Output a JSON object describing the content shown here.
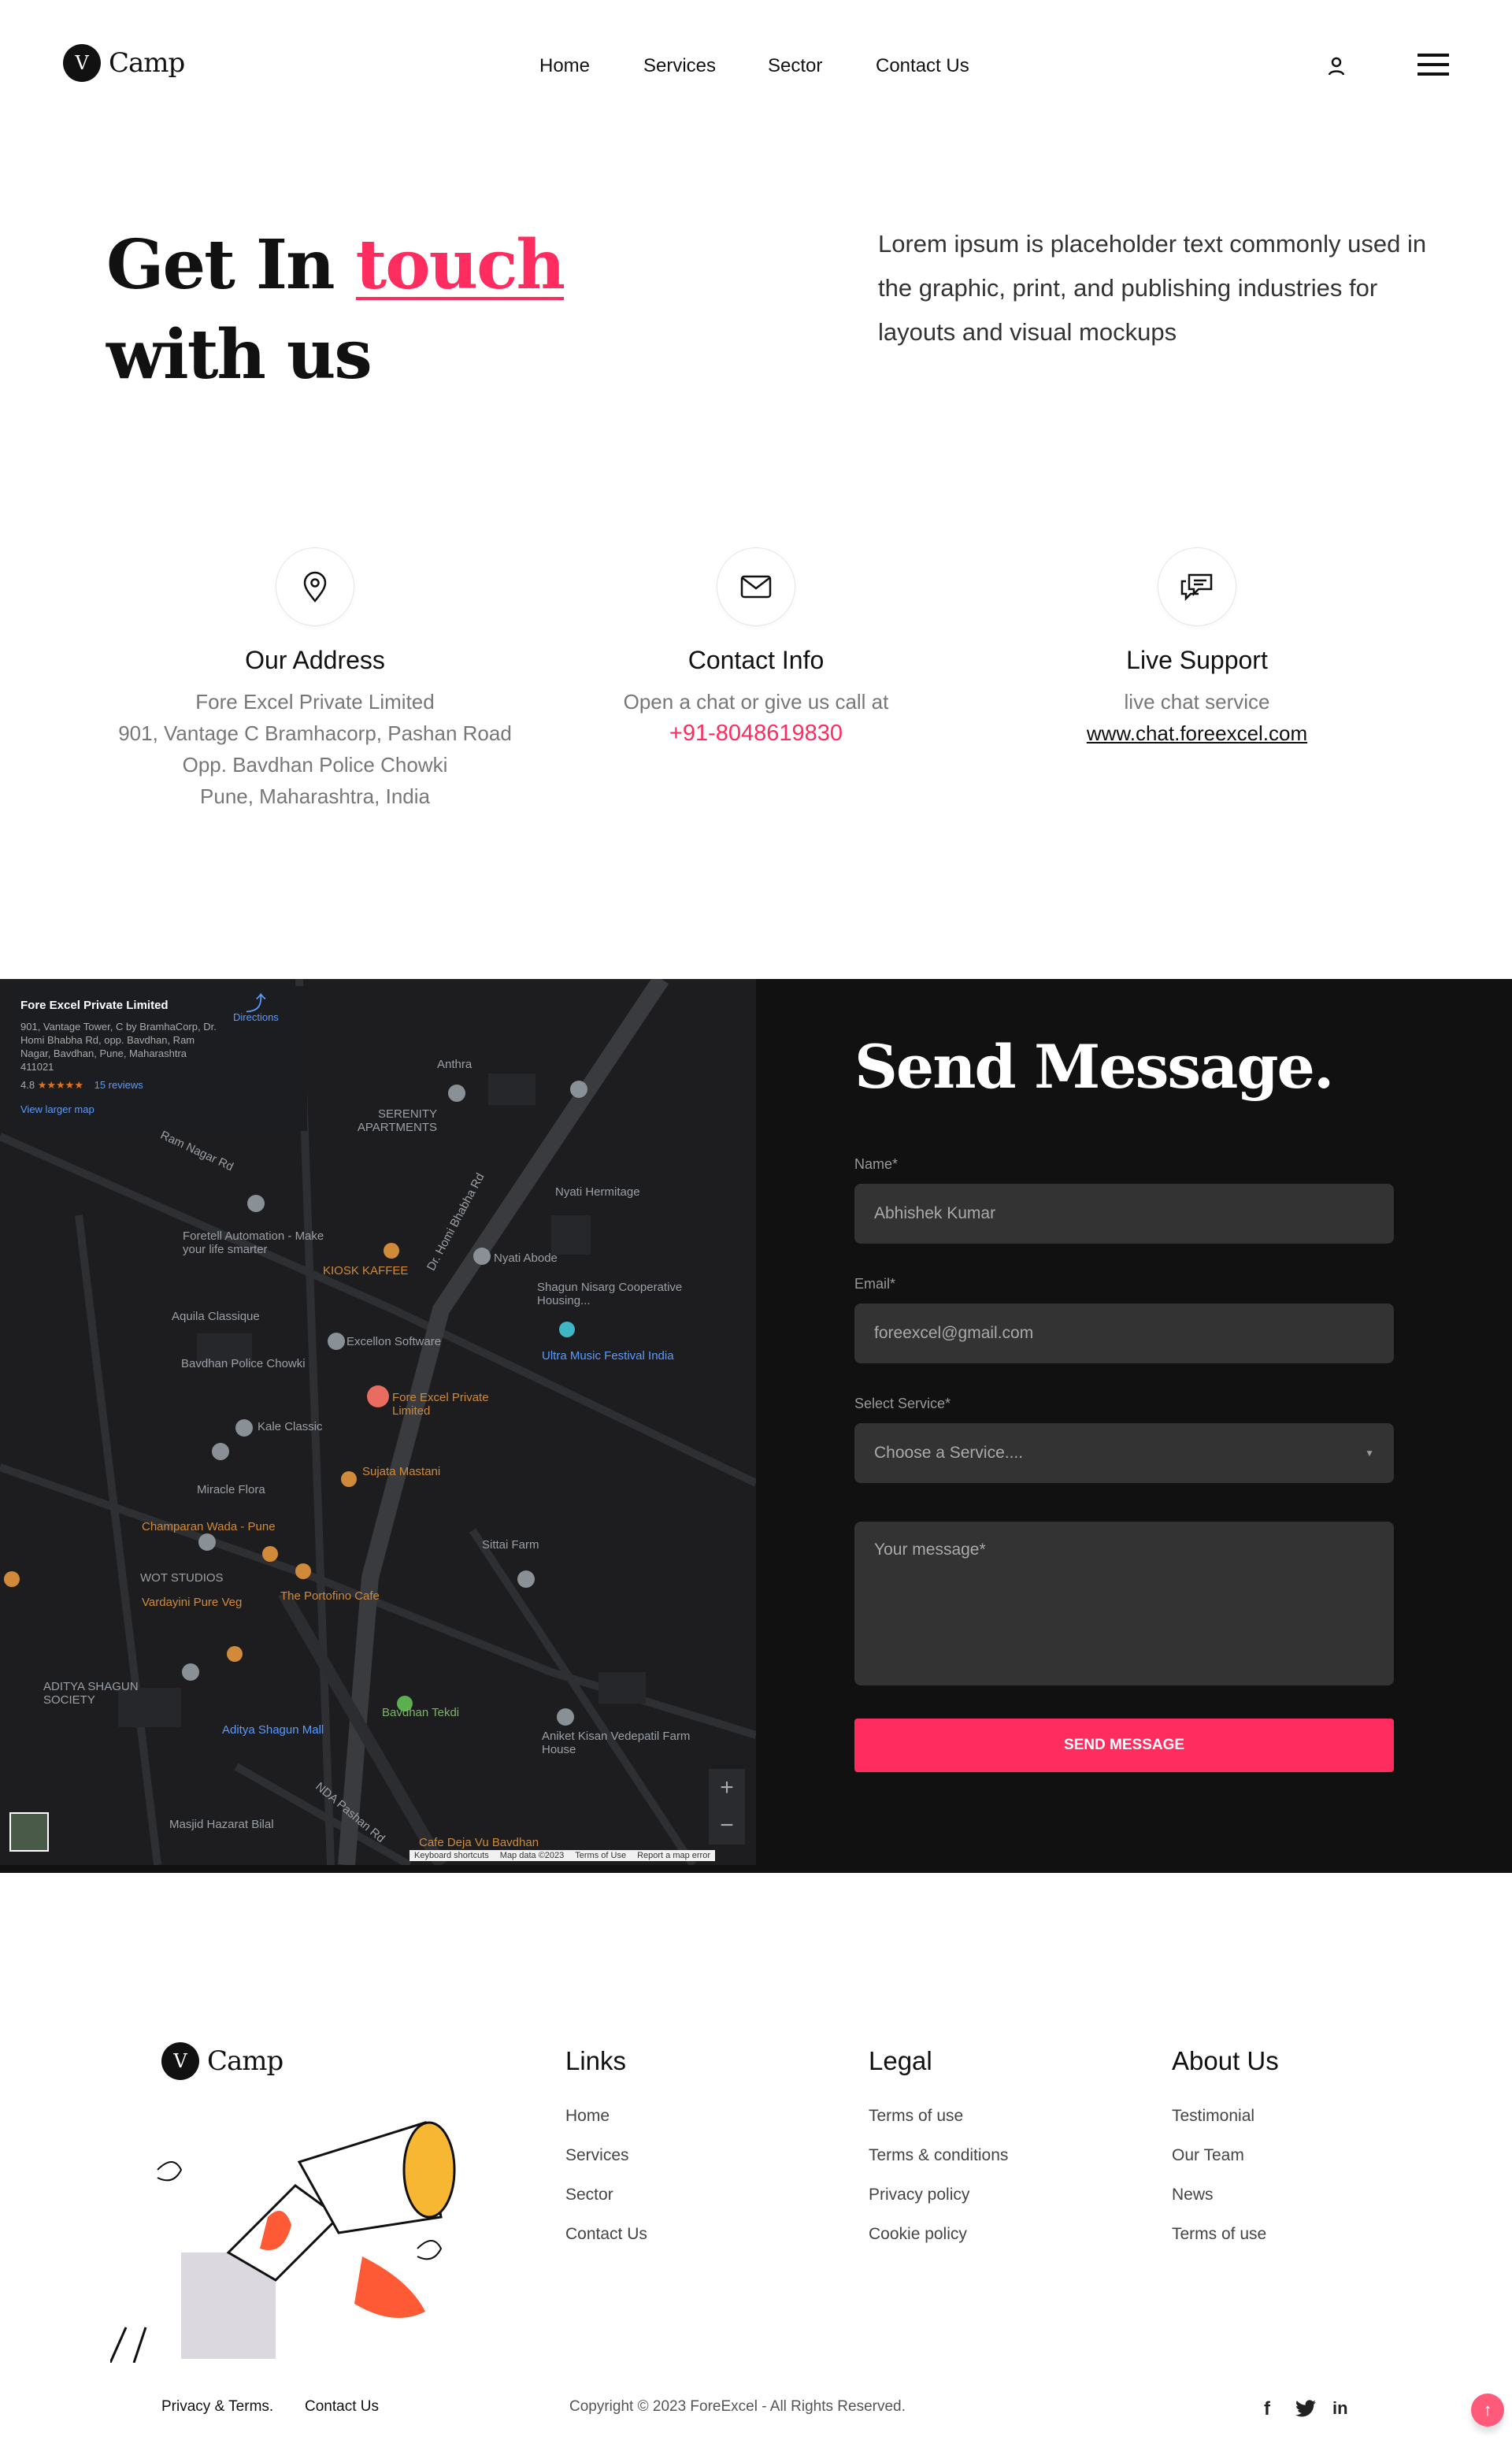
{
  "header": {
    "logo_letter": "V",
    "logo_text": "Camp",
    "nav": [
      "Home",
      "Services",
      "Sector",
      "Contact Us"
    ]
  },
  "hero": {
    "title_1": "Get In",
    "title_accent": "touch",
    "title_2": "with us",
    "paragraph": "Lorem ipsum is placeholder text commonly used in the graphic, print, and publishing industries for layouts and visual mockups"
  },
  "cards": [
    {
      "icon": "location-pin-icon",
      "title": "Our Address",
      "lines": [
        "Fore Excel Private Limited",
        "901, Vantage C Bramhacorp, Pashan Road",
        "Opp. Bavdhan Police Chowki",
        "Pune, Maharashtra, India"
      ]
    },
    {
      "icon": "mail-icon",
      "title": "Contact Info",
      "lines": [
        "Open a chat or give us call at"
      ],
      "phone": "+91-8048619830"
    },
    {
      "icon": "chat-icon",
      "title": "Live Support",
      "lines": [
        "live chat service"
      ],
      "link": "www.chat.foreexcel.com"
    }
  ],
  "map": {
    "info": {
      "name": "Fore Excel Private Limited",
      "address": "901, Vantage Tower, C by BramhaCorp, Dr. Homi Bhabha Rd, opp. Bavdhan, Ram Nagar, Bavdhan, Pune, Maharashtra 411021",
      "rating": "4.8",
      "stars": "★★★★★",
      "reviews": "15 reviews",
      "directions": "Directions",
      "larger": "View larger map"
    },
    "labels": [
      "Anthra",
      "SERENITY APARTMENTS",
      "Ram Nagar Rd",
      "Dr. Homi Bhabha Rd",
      "Nyati Hermitage",
      "Foretell Automation - Make your life smarter",
      "KIOSK KAFFEE",
      "Nyati Abode",
      "Shagun Nisarg Cooperative Housing...",
      "Aquila Classique",
      "Excellon Software",
      "Ultra Music Festival India",
      "Bavdhan Police Chowki",
      "Fore Excel Private Limited",
      "Kale Classic",
      "Sujata Mastani",
      "Miracle Flora",
      "Champaran Wada - Pune",
      "Sittai Farm",
      "WOT STUDIOS",
      "The Portofino Cafe",
      "Vardayini Pure Veg",
      "ADITYA SHAGUN SOCIETY",
      "Aditya Shagun Mall",
      "Bavdhan Tekdi",
      "Aniket Kisan Vedepatil Farm House",
      "Masjid Hazarat Bilal",
      "Cafe Deja Vu Bavdhan",
      "NDA Pashan Rd"
    ],
    "footer": [
      "Keyboard shortcuts",
      "Map data ©2023",
      "Terms of Use",
      "Report a map error"
    ]
  },
  "form": {
    "title": "Send Message.",
    "name_label": "Name*",
    "name_value": "Abhishek Kumar",
    "email_label": "Email*",
    "email_value": "foreexcel@gmail.com",
    "service_label": "Select Service*",
    "service_value": "Choose a Service....",
    "message_placeholder": "Your message*",
    "submit": "SEND MESSAGE"
  },
  "footer": {
    "logo_letter": "V",
    "logo_text": "Camp",
    "columns": [
      {
        "title": "Links",
        "items": [
          "Home",
          "Services",
          "Sector",
          "Contact Us"
        ]
      },
      {
        "title": "Legal",
        "items": [
          "Terms of use",
          "Terms & conditions",
          "Privacy policy",
          "Cookie policy"
        ]
      },
      {
        "title": "About Us",
        "items": [
          "Testimonial",
          "Our Team",
          "News",
          "Terms of use"
        ]
      }
    ],
    "bottom_links": [
      "Privacy & Terms.",
      "Contact Us"
    ],
    "copyright": "Copyright © 2023 ForeExcel - All Rights Reserved.",
    "social": [
      "facebook-icon",
      "twitter-icon",
      "linkedin-icon"
    ]
  },
  "colors": {
    "accent": "#ff2d5f",
    "dark": "#111111",
    "field": "#333333"
  }
}
